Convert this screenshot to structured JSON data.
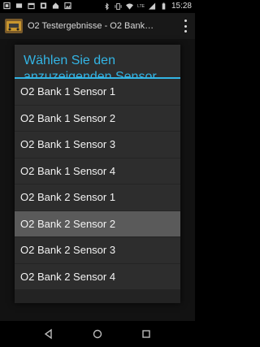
{
  "status_bar": {
    "time": "15:28",
    "network": "LTE",
    "left_icons": [
      "notification-icon",
      "app-icon",
      "calendar-icon",
      "photo-icon",
      "home-icon",
      "image-icon"
    ],
    "right_icons": [
      "bluetooth-icon",
      "vibrate-icon",
      "wifi-icon",
      "signal-icon",
      "battery-icon"
    ]
  },
  "action_bar": {
    "title": "O2 Testergebnisse - O2 Bank…",
    "menu_icon": "overflow-menu-icon"
  },
  "dialog": {
    "title": "Wählen Sie den anzuzeigenden Sensor",
    "accent_color": "#33b5e5",
    "items": [
      {
        "label": "O2 Bank 1 Sensor 1",
        "selected": false
      },
      {
        "label": "O2 Bank 1 Sensor 2",
        "selected": false
      },
      {
        "label": "O2 Bank 1 Sensor 3",
        "selected": false
      },
      {
        "label": "O2 Bank 1 Sensor 4",
        "selected": false
      },
      {
        "label": "O2 Bank 2 Sensor 1",
        "selected": false
      },
      {
        "label": "O2 Bank 2 Sensor 2",
        "selected": true
      },
      {
        "label": "O2 Bank 2 Sensor 3",
        "selected": false
      },
      {
        "label": "O2 Bank 2 Sensor 4",
        "selected": false
      }
    ]
  },
  "nav_bar": {
    "icons": [
      "back-icon",
      "home-icon",
      "recents-icon"
    ]
  }
}
